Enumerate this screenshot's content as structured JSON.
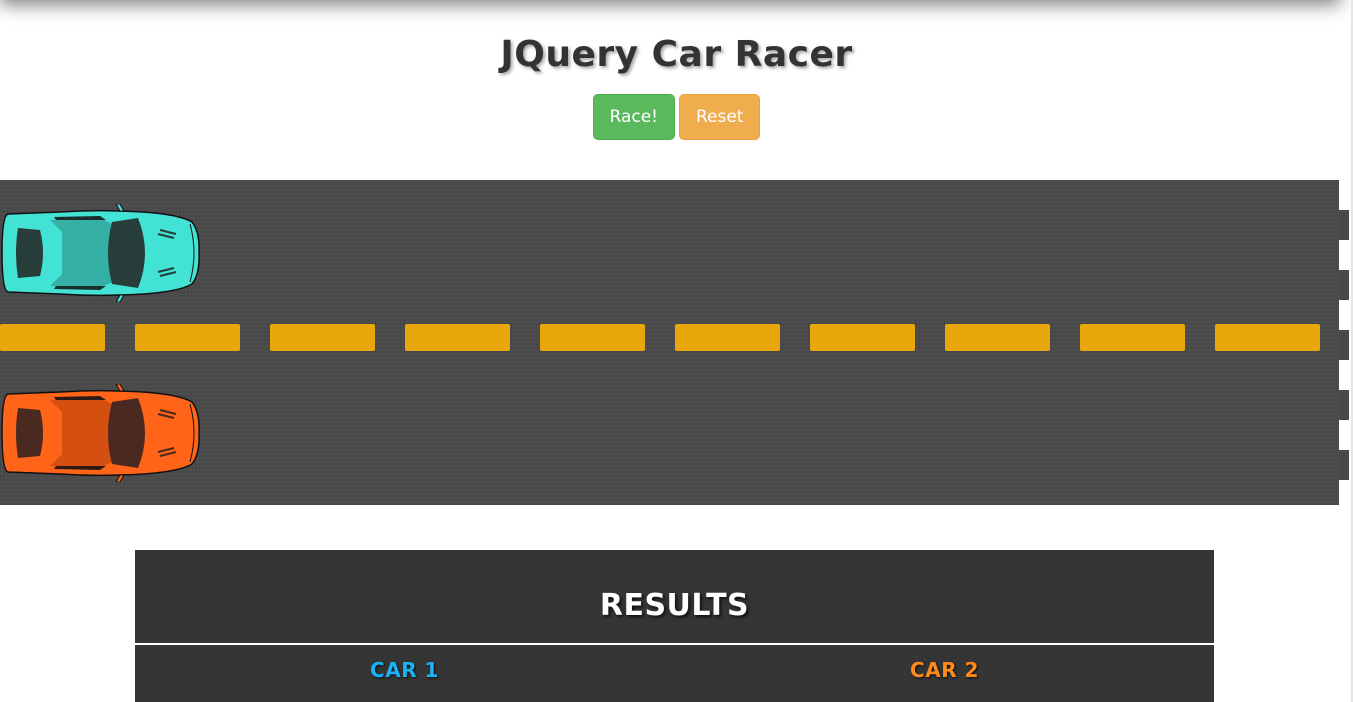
{
  "header": {
    "title": "JQuery Car Racer"
  },
  "controls": {
    "race_label": "Race!",
    "reset_label": "Reset"
  },
  "track": {
    "asphalt_color": "#494949",
    "lane_marking_color": "#e8a70a",
    "cars": [
      {
        "id": "car-1",
        "color": "#42e2d4",
        "progress": 0
      },
      {
        "id": "car-2",
        "color": "#ff6418",
        "progress": 0
      }
    ],
    "finish_line_icon": "checkered-finish-line"
  },
  "results": {
    "title": "RESULTS",
    "columns": [
      {
        "label": "CAR 1",
        "color": "#1ab2f5"
      },
      {
        "label": "CAR 2",
        "color": "#ff8a1c"
      }
    ]
  }
}
